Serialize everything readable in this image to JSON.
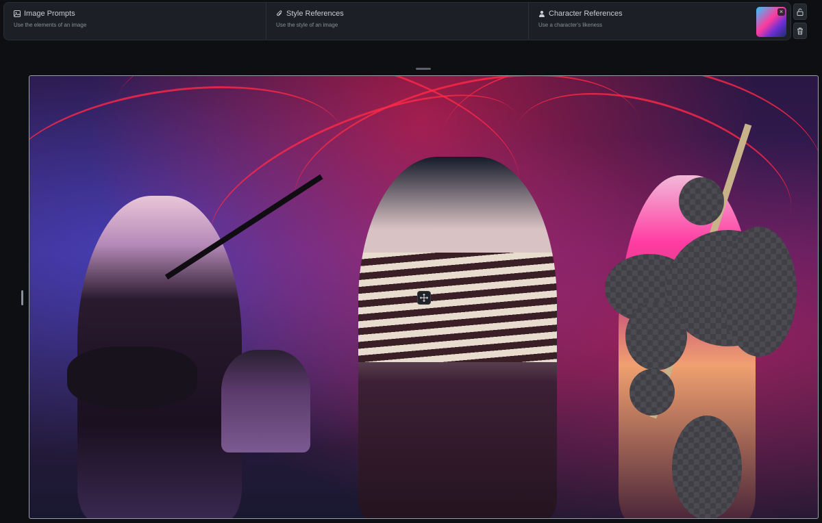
{
  "references": {
    "image_prompts": {
      "title": "Image Prompts",
      "subtitle": "Use the elements of an image"
    },
    "style_references": {
      "title": "Style References",
      "subtitle": "Use the style of an image"
    },
    "character_references": {
      "title": "Character References",
      "subtitle": "Use a character's likeness"
    }
  },
  "thumbnail": {
    "close_icon": "×"
  },
  "side_buttons": {
    "unlock_icon": "unlock-icon",
    "delete_icon": "trash-icon"
  },
  "canvas": {
    "move_icon": "move-icon"
  }
}
